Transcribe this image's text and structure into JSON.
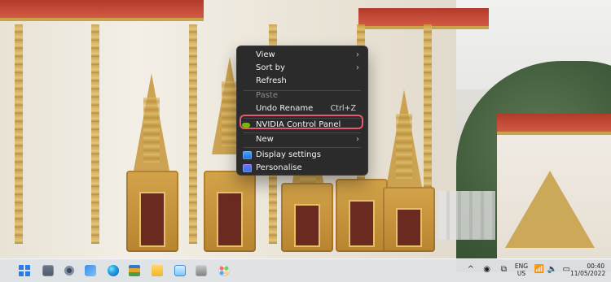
{
  "context_menu": {
    "items": [
      {
        "label": "View",
        "has_submenu": true
      },
      {
        "label": "Sort by",
        "has_submenu": true
      },
      {
        "label": "Refresh"
      },
      {
        "label": "Paste",
        "disabled": true
      },
      {
        "label": "Undo Rename",
        "shortcut": "Ctrl+Z"
      },
      {
        "label": "NVIDIA Control Panel",
        "highlighted": true
      },
      {
        "label": "New",
        "has_submenu": true
      },
      {
        "label": "Display settings"
      },
      {
        "label": "Personalise"
      }
    ],
    "submenu_glyph": "›"
  },
  "icons": {
    "submenu": "chevron-right-icon",
    "nvidia": "nvidia-icon",
    "display_settings": "monitor-icon",
    "personalise": "personalise-icon"
  },
  "colors": {
    "menu_bg": "#2b2b2b",
    "menu_text": "#f2f2f2",
    "highlight_ring": "#e05b6f",
    "taskbar_bg": "#e1e4e8"
  },
  "taskbar": {
    "apps": [
      {
        "name": "start"
      },
      {
        "name": "taskview"
      },
      {
        "name": "settings"
      },
      {
        "name": "photos"
      },
      {
        "name": "edge"
      },
      {
        "name": "layers"
      },
      {
        "name": "file-explorer"
      },
      {
        "name": "notepad"
      },
      {
        "name": "media"
      },
      {
        "name": "paint"
      }
    ],
    "tray": {
      "chevron": "^",
      "lang_line1": "ENG",
      "lang_line2": "US",
      "time": "00:40",
      "date": "11/05/2022"
    }
  }
}
